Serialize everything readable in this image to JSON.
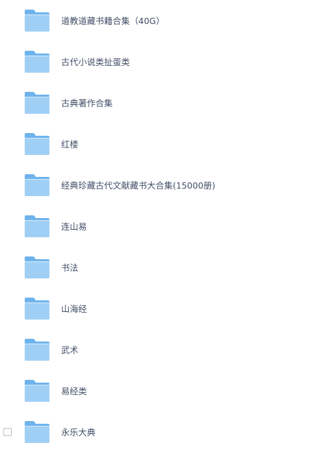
{
  "folders": [
    {
      "name": "道教道藏书籍合集（40G）",
      "icon": "folder-icon",
      "checkbox_visible": false
    },
    {
      "name": "古代小说类扯蛋类",
      "icon": "folder-icon",
      "checkbox_visible": false
    },
    {
      "name": "古典著作合集",
      "icon": "folder-icon",
      "checkbox_visible": false
    },
    {
      "name": "红楼",
      "icon": "folder-icon",
      "checkbox_visible": false
    },
    {
      "name": "经典珍藏古代文献藏书大合集(15000册)",
      "icon": "folder-icon",
      "checkbox_visible": false
    },
    {
      "name": "连山易",
      "icon": "folder-icon",
      "checkbox_visible": false
    },
    {
      "name": "书法",
      "icon": "folder-icon",
      "checkbox_visible": false
    },
    {
      "name": "山海经",
      "icon": "folder-icon",
      "checkbox_visible": false
    },
    {
      "name": "武术",
      "icon": "folder-icon",
      "checkbox_visible": false
    },
    {
      "name": "易经类",
      "icon": "folder-icon",
      "checkbox_visible": false
    },
    {
      "name": "永乐大典",
      "icon": "folder-icon",
      "checkbox_visible": true
    }
  ],
  "colors": {
    "folder_back": "#6fb3ec",
    "folder_front": "#9fcff5",
    "text": "#424e67",
    "checkbox_border": "#b7bcc3"
  }
}
